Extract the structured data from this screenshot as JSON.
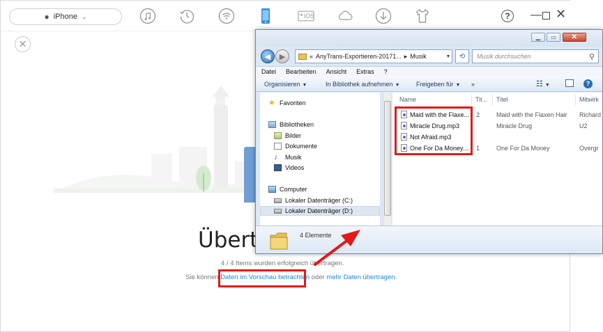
{
  "anytrans": {
    "device_name": "iPhone",
    "toolbar_icons": [
      "music-icon",
      "history-icon",
      "wifi-icon",
      "phone-icon",
      "ios-icon",
      "cloud-icon",
      "download-icon",
      "shirt-icon"
    ],
    "ios_label": "iOS",
    "help": "?",
    "title": "Übertra",
    "status": "4 / 4 Items wurden erfolgreich übertragen.",
    "link_prefix": "Sie können",
    "link_preview": "Daten im Vorschau betrachten",
    "link_middle": "oder",
    "link_more": "mehr Daten übertragen."
  },
  "explorer": {
    "address_prefix": "«",
    "address_path": "AnyTrans-Exportieren-20171...",
    "address_sep": "▸",
    "address_folder": "Musik",
    "search_placeholder": "Musik durchsuchen",
    "menu": [
      "Datei",
      "Bearbeiten",
      "Ansicht",
      "Extras",
      "?"
    ],
    "commands": {
      "organize": "Organisieren",
      "library": "In Bibliothek aufnehmen",
      "share": "Freigeben für",
      "more": "»"
    },
    "nav": {
      "favorites": "Favoriten",
      "libraries": "Bibliotheken",
      "pictures": "Bilder",
      "documents": "Dokumente",
      "music": "Musik",
      "videos": "Videos",
      "computer": "Computer",
      "drive_c": "Lokaler Datenträger (C:)",
      "drive_d": "Lokaler Datenträger (D:)"
    },
    "columns": [
      "Name",
      "Tit...",
      "Titel",
      "Mitwirk"
    ],
    "files": [
      {
        "name": "Maid with the Flaxe...",
        "track": "2",
        "title": "Maid with the Flaxen Hair",
        "artist": "Richard"
      },
      {
        "name": "Miracle Drug.mp3",
        "track": "",
        "title": "Miracle Drug",
        "artist": "U2"
      },
      {
        "name": "Not Afraid.mp3",
        "track": "",
        "title": "",
        "artist": ""
      },
      {
        "name": "One For Da Money....",
        "track": "1",
        "title": "One For Da Money",
        "artist": "Overgr"
      }
    ],
    "details": "4 Elemente"
  },
  "colors": {
    "highlight_red": "#e01a1a",
    "link_blue": "#1a8bd8",
    "active_icon_blue": "#2e8fe0"
  }
}
